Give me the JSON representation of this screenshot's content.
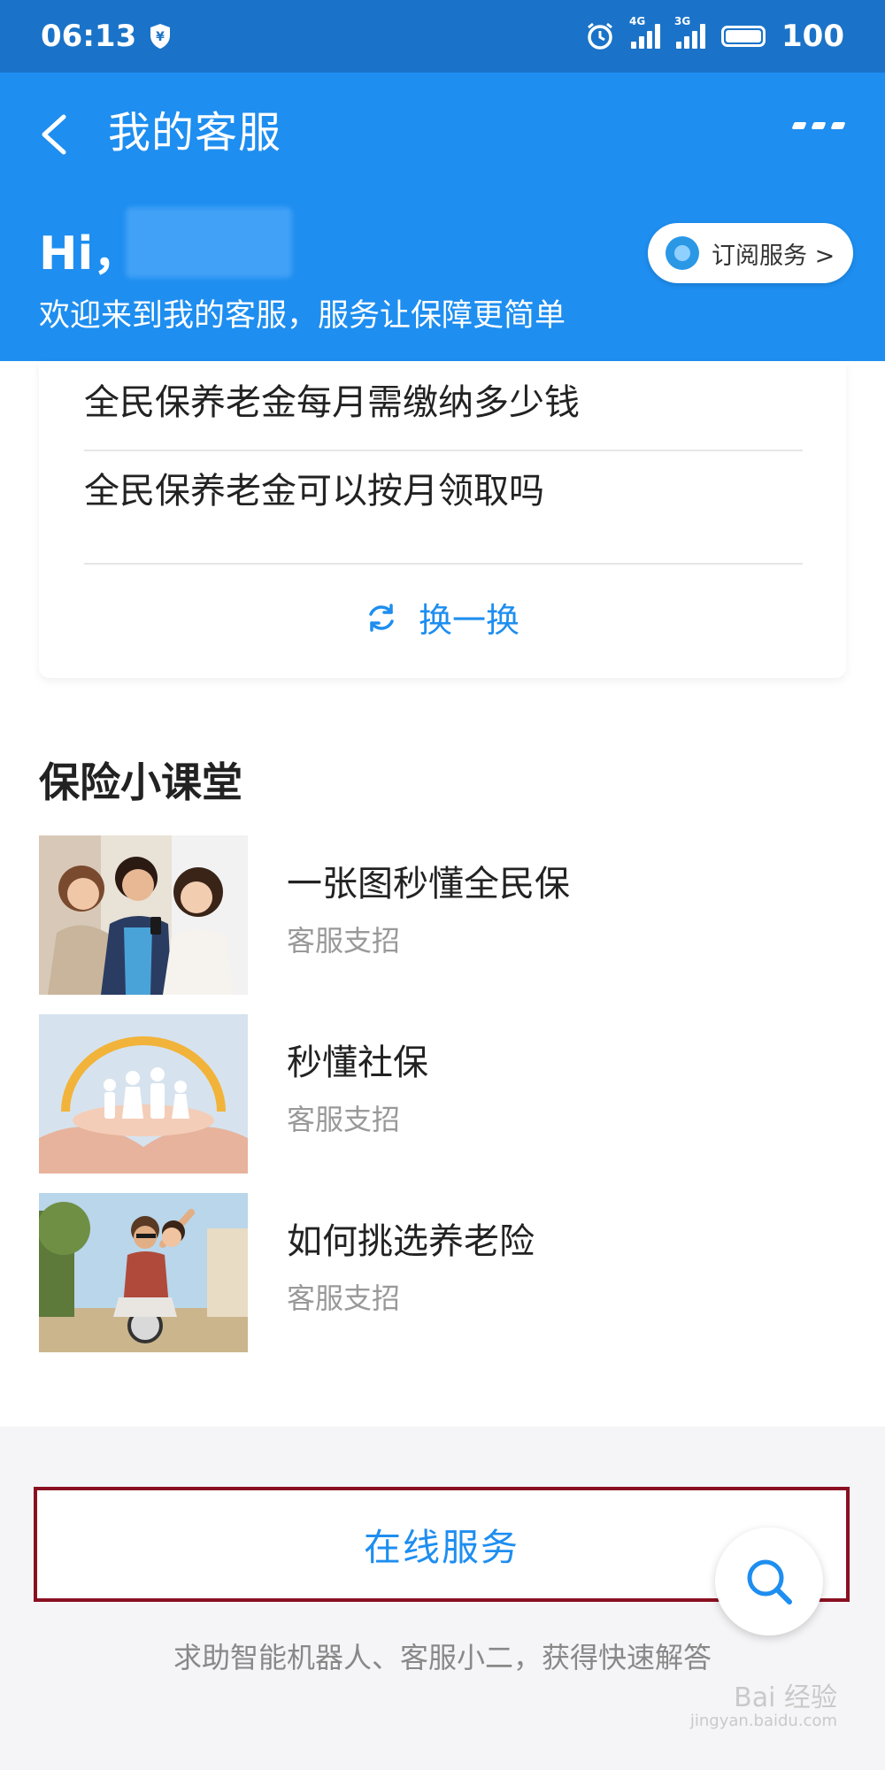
{
  "status_bar": {
    "time": "06:13",
    "network_1": "4G",
    "network_2": "3G",
    "battery": "100"
  },
  "header": {
    "title": "我的客服",
    "greeting": "Hi，",
    "welcome": "欢迎来到我的客服，服务让保障更简单",
    "subscribe_label": "订阅服务 >"
  },
  "faq": {
    "items": [
      "全民保养老金每月需缴纳多少钱",
      "全民保养老金可以按月领取吗"
    ],
    "refresh_label": "换一换"
  },
  "classroom": {
    "title": "保险小课堂",
    "courses": [
      {
        "title": "一张图秒懂全民保",
        "source": "客服支招",
        "thumb_icon": "friends-photo"
      },
      {
        "title": "秒懂社保",
        "source": "客服支招",
        "thumb_icon": "family-hands-photo"
      },
      {
        "title": "如何挑选养老险",
        "source": "客服支招",
        "thumb_icon": "scooter-couple-photo"
      }
    ]
  },
  "bottom": {
    "online_service_label": "在线服务",
    "hint": "求助智能机器人、客服小二，获得快速解答",
    "watermark_main": "Bai 经验",
    "watermark_sub": "jingyan.baidu.com"
  },
  "colors": {
    "status_bar": "#1a73c8",
    "header": "#1e8ef0",
    "accent": "#1e8ef0",
    "highlight_border": "#8a1021"
  }
}
